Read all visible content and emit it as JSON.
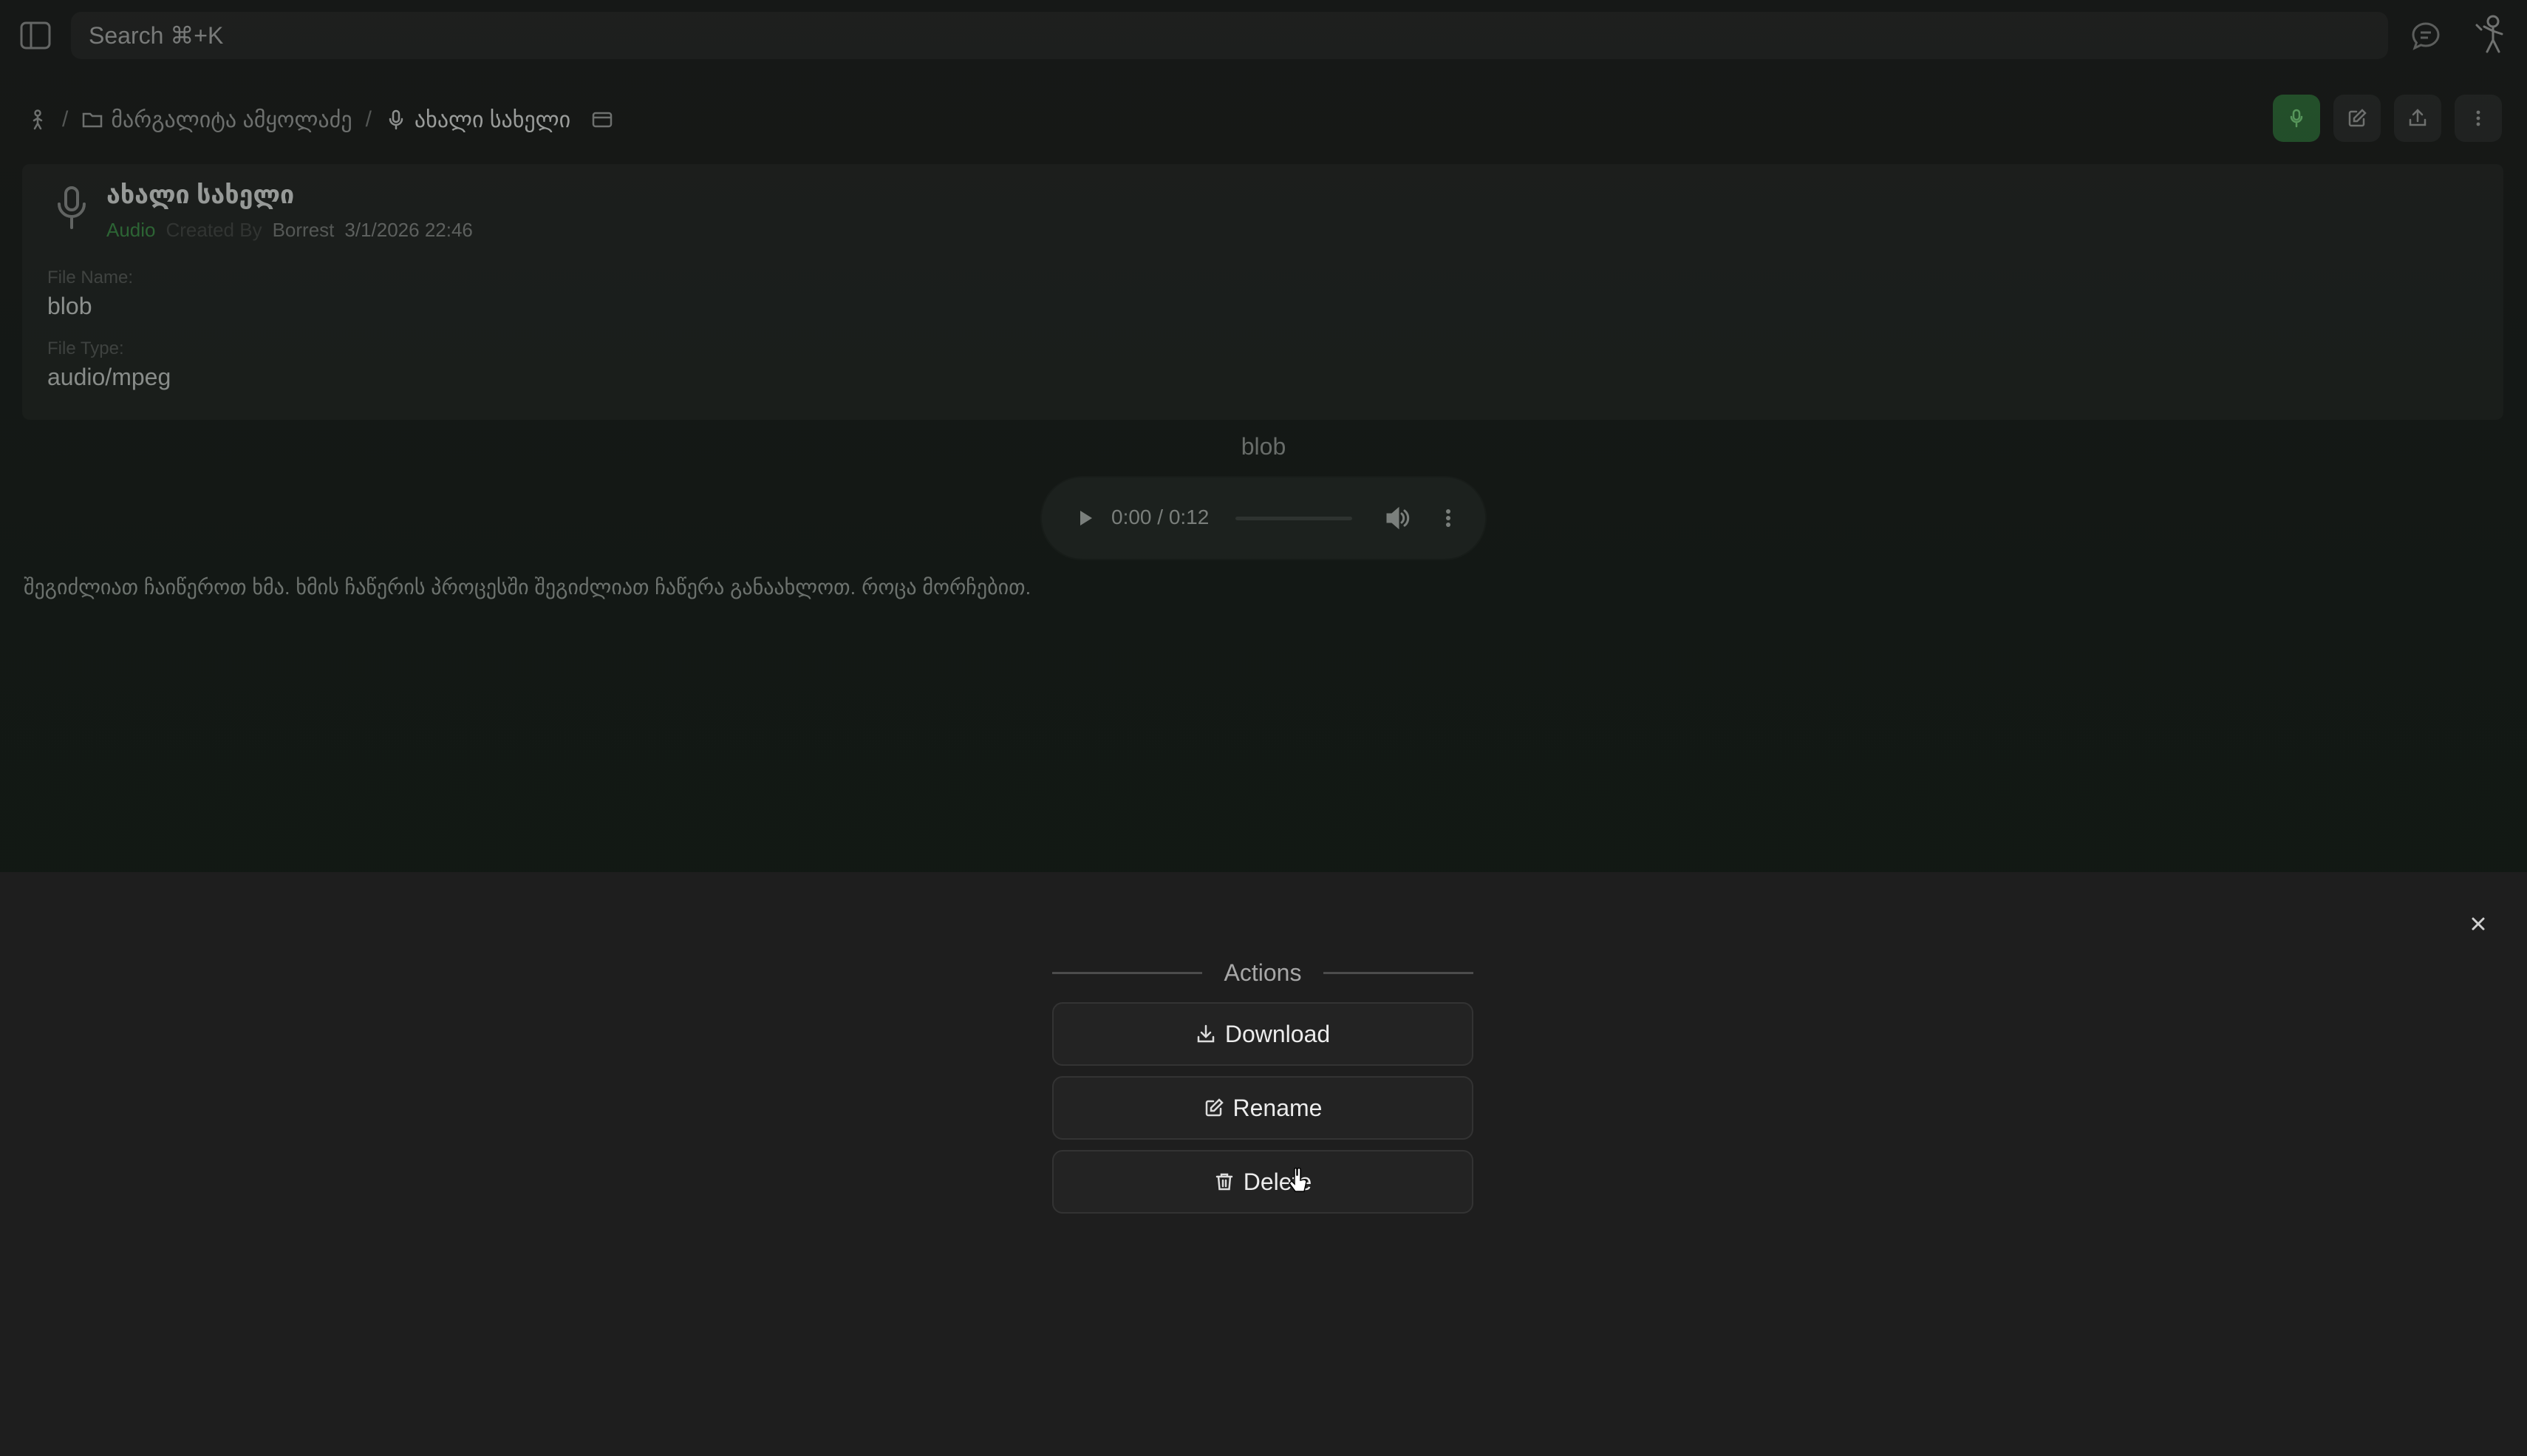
{
  "search": {
    "placeholder": "Search ⌘+K"
  },
  "breadcrumb": {
    "separator": "/",
    "folder": "მარგალიტა ამყოლაძე",
    "current": "ახალი სახელი"
  },
  "record": {
    "title": "ახალი სახელი",
    "type": "Audio",
    "created_by_label": "Created By",
    "author": "Borrest",
    "date": "3/1/2026 22:46",
    "file_name_label": "File Name:",
    "file_name": "blob",
    "file_type_label": "File Type:",
    "file_type": "audio/mpeg"
  },
  "audio": {
    "label": "blob",
    "time": "0:00 / 0:12"
  },
  "description": "შეგიძლიათ ჩაიწეროთ ხმა. ხმის ჩაწერის პროცესში შეგიძლიათ ჩაწერა განაახლოთ. როცა მორჩებით.",
  "drawer": {
    "title": "Actions",
    "download": "Download",
    "rename": "Rename",
    "delete": "Delete"
  },
  "colors": {
    "accent_green": "#3f8f49",
    "record_button": "#2f6b38"
  },
  "icons": [
    "sidebar-toggle-icon",
    "chat-icon",
    "user-avatar-icon",
    "home-icon",
    "folder-icon",
    "microphone-icon",
    "window-icon",
    "record-icon",
    "edit-icon",
    "share-icon",
    "more-vertical-icon",
    "play-icon",
    "volume-icon",
    "close-icon",
    "download-icon",
    "rename-icon",
    "trash-icon"
  ]
}
